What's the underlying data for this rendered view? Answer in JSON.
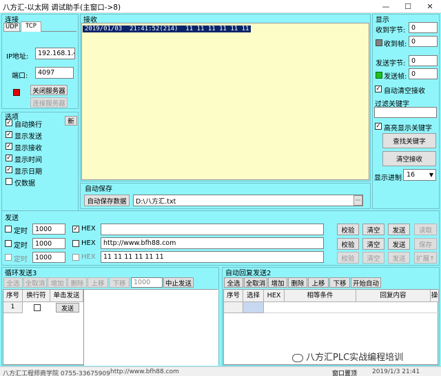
{
  "window": {
    "title": "八方汇-以太网 调试助手(主窗口->8)",
    "min": "—",
    "max": "☐",
    "close": "✕"
  },
  "conn": {
    "title": "连接",
    "tabs": [
      "UDP",
      "TCP"
    ],
    "ip_label": "IP地址:",
    "ip_value": "192.168.1.4",
    "port_label": "端口:",
    "port_value": "4097",
    "close_server": "关闭服务器",
    "connect_server": "连接服务器",
    "status_color": "#e00000"
  },
  "options": {
    "title": "选项",
    "new_btn": "新",
    "items": [
      {
        "label": "自动换行",
        "checked": true
      },
      {
        "label": "显示发送",
        "checked": true
      },
      {
        "label": "显示接收",
        "checked": true
      },
      {
        "label": "显示时间",
        "checked": true
      },
      {
        "label": "显示日期",
        "checked": true
      },
      {
        "label": "仅数据",
        "checked": false
      }
    ]
  },
  "receive": {
    "title": "接收",
    "line": "2019/01/03  21:41:52(214)  11 11 11 11 11 11",
    "bg": "#fdfdc8"
  },
  "autosave": {
    "title": "自动保存",
    "button": "自动保存数据",
    "path": "D:\\八方汇.txt",
    "browse": "···"
  },
  "display": {
    "title": "显示",
    "recv_bytes_label": "收到字节:",
    "recv_bytes": "0",
    "recv_frames_label": "收到帧:",
    "recv_frames": "0",
    "send_bytes_label": "发送字节:",
    "send_bytes": "0",
    "send_frames_label": "发送帧:",
    "send_frames": "0",
    "auto_clear_label": "自动清空接收",
    "filter_label": "过滤关键字",
    "filter_value": "",
    "highlight_label": "高亮显示关键字",
    "find_btn": "查找关键字",
    "clear_btn": "清空接收",
    "radix_label": "显示进制",
    "radix_value": "16"
  },
  "send": {
    "title": "发送",
    "timed_label": "定时",
    "hex_label": "HEX",
    "rows": [
      {
        "interval": "1000",
        "hex": true,
        "text": "",
        "check": "校验",
        "clear": "清空",
        "send": "发送",
        "extra": "读取",
        "extra_disabled": true,
        "disabled": false
      },
      {
        "interval": "1000",
        "hex": false,
        "text": "http://www.bfh88.com",
        "check": "校验",
        "clear": "清空",
        "send": "发送",
        "extra": "保存",
        "extra_disabled": true,
        "disabled": false
      },
      {
        "interval": "1000",
        "hex": false,
        "text": "11 11 11 11 11 11",
        "check": "校验",
        "clear": "清空",
        "send": "发送",
        "extra": "扩展↑",
        "extra_disabled": true,
        "disabled": true
      }
    ]
  },
  "loop": {
    "title": "循环发送3",
    "toolbar": [
      "全选",
      "全取消",
      "增加",
      "删除",
      "上移",
      "下移"
    ],
    "interval": "1000",
    "stop_btn": "中止发送",
    "columns": [
      "序号",
      "换行符",
      "单击发送"
    ],
    "row": {
      "index": "1",
      "send": "发送"
    }
  },
  "autoreply": {
    "title": "自动回复发送2",
    "toolbar": [
      "全选",
      "全取消",
      "增加",
      "删除",
      "上移",
      "下移",
      "开始自动"
    ],
    "columns": [
      "序号",
      "选择",
      "HEX",
      "相等条件",
      "回复内容",
      "操"
    ]
  },
  "status": {
    "left": "八方汇工程师商学院  0755-33675909",
    "url": "http://www.bfh88.com",
    "window_reset": "窗口置顶",
    "datetime": "2019/1/3  21:41"
  },
  "watermark": "八方汇PLC实战编程培训"
}
